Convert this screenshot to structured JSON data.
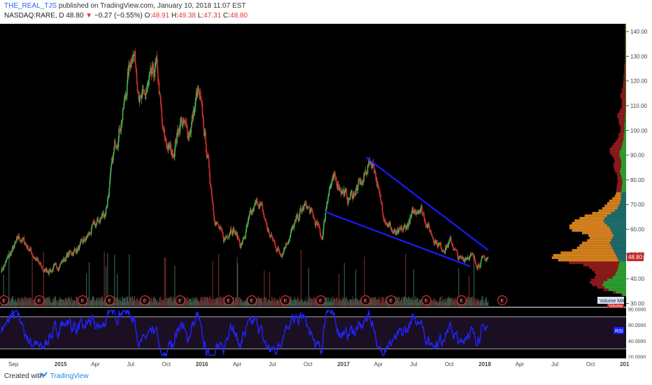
{
  "header": {
    "author": "THE_REAL_TJS",
    "published_text": "published on TradingView.com, January 10, 2018 11:07 EST",
    "symbol": "NASDAQ:RARE, D",
    "last": "48.80",
    "arrow": "▼",
    "change": "−0.27 (−0.55%)",
    "o_label": "O:",
    "o_value": "48.91",
    "h_label": "H:",
    "h_value": "49.38",
    "l_label": "L:",
    "l_value": "47.31",
    "c_label": "C:",
    "c_value": "48.80"
  },
  "footer": {
    "created": "Created with",
    "brand": "TradingView"
  },
  "colors": {
    "background": "#000000",
    "up": "#4caf50",
    "down": "#d32f2f",
    "trendline": "#1a1aff",
    "rsi": "#2323ff",
    "rsi_band": "#1b0f24",
    "vp_up": "#2e9e2e",
    "vp_down": "#8b1a1a",
    "vp_up_va": "#1e6b6b",
    "vp_down_va": "#d2801e",
    "price_tag": "#c62828",
    "earn": "#e53935"
  },
  "chart_data": {
    "type": "candlestick",
    "symbol": "NASDAQ:RARE",
    "interval": "D",
    "last_price": 48.8,
    "price_axis": {
      "ticks": [
        30,
        40,
        50,
        60,
        70,
        80,
        90,
        100,
        110,
        120,
        130,
        140
      ],
      "labels": [
        "30.00",
        "40.00",
        "50.00",
        "60.00",
        "70.00",
        "80.00",
        "90.00",
        "100.00",
        "110.00",
        "120.00",
        "130.00",
        "140.00"
      ],
      "ylim": [
        29,
        142
      ]
    },
    "time_axis": {
      "labels": [
        "Sep",
        "2015",
        "Apr",
        "Jul",
        "Oct",
        "2016",
        "Apr",
        "Jul",
        "Oct",
        "2017",
        "Apr",
        "Jul",
        "Oct",
        "2018",
        "Apr",
        "Jul",
        "Oct",
        "201"
      ],
      "start": "2014-08-01",
      "end": "2019-01-01"
    },
    "price_path": [
      [
        "2014-08-01",
        44
      ],
      [
        "2014-09-15",
        57
      ],
      [
        "2014-10-10",
        52
      ],
      [
        "2014-11-15",
        43
      ],
      [
        "2014-12-15",
        44
      ],
      [
        "2015-01-20",
        50
      ],
      [
        "2015-02-20",
        53
      ],
      [
        "2015-03-25",
        61
      ],
      [
        "2015-04-25",
        67
      ],
      [
        "2015-05-20",
        95
      ],
      [
        "2015-06-10",
        108
      ],
      [
        "2015-06-25",
        126
      ],
      [
        "2015-07-05",
        135
      ],
      [
        "2015-07-25",
        110
      ],
      [
        "2015-08-20",
        120
      ],
      [
        "2015-09-05",
        126
      ],
      [
        "2015-09-20",
        97
      ],
      [
        "2015-10-15",
        90
      ],
      [
        "2015-11-05",
        105
      ],
      [
        "2015-11-25",
        98
      ],
      [
        "2015-12-10",
        108
      ],
      [
        "2015-12-20",
        117
      ],
      [
        "2016-01-10",
        93
      ],
      [
        "2016-02-01",
        64
      ],
      [
        "2016-02-25",
        55
      ],
      [
        "2016-03-15",
        62
      ],
      [
        "2016-04-10",
        53
      ],
      [
        "2016-05-05",
        66
      ],
      [
        "2016-05-25",
        72
      ],
      [
        "2016-06-20",
        58
      ],
      [
        "2016-07-20",
        50
      ],
      [
        "2016-08-20",
        60
      ],
      [
        "2016-09-10",
        67
      ],
      [
        "2016-09-25",
        70
      ],
      [
        "2016-10-20",
        62
      ],
      [
        "2016-11-05",
        56
      ],
      [
        "2016-11-20",
        77
      ],
      [
        "2016-12-10",
        80
      ],
      [
        "2017-01-10",
        72
      ],
      [
        "2017-02-01",
        76
      ],
      [
        "2017-02-20",
        80
      ],
      [
        "2017-03-05",
        88
      ],
      [
        "2017-03-20",
        86
      ],
      [
        "2017-04-01",
        72
      ],
      [
        "2017-04-20",
        63
      ],
      [
        "2017-05-15",
        57
      ],
      [
        "2017-06-10",
        61
      ],
      [
        "2017-07-01",
        67
      ],
      [
        "2017-07-15",
        70
      ],
      [
        "2017-08-10",
        59
      ],
      [
        "2017-09-10",
        52
      ],
      [
        "2017-10-05",
        55
      ],
      [
        "2017-10-25",
        47
      ],
      [
        "2017-11-20",
        50
      ],
      [
        "2017-12-10",
        46
      ],
      [
        "2018-01-10",
        48.8
      ]
    ],
    "volume_ma_label": "Volume MA",
    "volume_label": "Volume",
    "earnings_label": "E",
    "earnings_dates": [
      "2014-08-08",
      "2014-11-07",
      "2015-02-27",
      "2015-05-08",
      "2015-08-07",
      "2015-11-06",
      "2016-03-10",
      "2016-05-09",
      "2016-08-04",
      "2016-11-03",
      "2017-02-27",
      "2017-05-04",
      "2017-08-03",
      "2017-11-02",
      "2018-02-15"
    ],
    "trendlines": [
      {
        "from": [
          "2017-03-01",
          89
        ],
        "to": [
          "2018-01-10",
          51.5
        ]
      },
      {
        "from": [
          "2016-11-15",
          67
        ],
        "to": [
          "2017-11-25",
          45
        ]
      }
    ],
    "volume_profile": {
      "bin_size": 1,
      "from": 33,
      "up": [
        6,
        16,
        28,
        34,
        38,
        36,
        30,
        22,
        18,
        16,
        14,
        13,
        12,
        11,
        12,
        14,
        16,
        18,
        20,
        22,
        24,
        26,
        24,
        22,
        20,
        22,
        24,
        26,
        30,
        34,
        36,
        34,
        30,
        24,
        18,
        14,
        12,
        10,
        9,
        8,
        8,
        8,
        8,
        7,
        7,
        6,
        6,
        7,
        8,
        9,
        10,
        9,
        8,
        8,
        8,
        9,
        10,
        11,
        10,
        8,
        7,
        6,
        5,
        4,
        4,
        4,
        3,
        3,
        3,
        3,
        2,
        2,
        2,
        2,
        1,
        1,
        1,
        1,
        1,
        1,
        1,
        1,
        1,
        1,
        1,
        1,
        1,
        1,
        1,
        1,
        1,
        1,
        1,
        1,
        1,
        1,
        1,
        1,
        1,
        1,
        1,
        1,
        1,
        1,
        1,
        1,
        1,
        1,
        1,
        1
      ],
      "down": [
        2,
        5,
        8,
        12,
        16,
        22,
        26,
        28,
        30,
        34,
        40,
        46,
        56,
        80,
        96,
        104,
        100,
        86,
        66,
        56,
        50,
        44,
        38,
        36,
        40,
        48,
        62,
        64,
        60,
        52,
        46,
        40,
        36,
        30,
        26,
        24,
        22,
        20,
        18,
        14,
        10,
        8,
        8,
        8,
        8,
        8,
        7,
        7,
        6,
        6,
        8,
        10,
        12,
        12,
        10,
        10,
        12,
        14,
        16,
        18,
        16,
        14,
        12,
        10,
        8,
        8,
        6,
        6,
        6,
        8,
        10,
        10,
        12,
        12,
        10,
        8,
        6,
        6,
        6,
        6,
        8,
        8,
        6,
        6,
        4,
        4,
        4,
        3,
        3,
        3,
        2,
        2,
        2,
        2,
        1,
        1,
        1,
        1,
        1,
        1,
        1,
        1,
        1,
        1,
        1,
        1,
        1,
        1,
        1,
        1
      ],
      "value_area": [
        47,
        75
      ]
    },
    "rsi": {
      "label": "RSI",
      "ticks": [
        20,
        40,
        60,
        80
      ],
      "tick_labels": [
        "20.0000",
        "40.0000",
        "60.0000",
        "80.0000"
      ],
      "ylim": [
        18,
        82
      ],
      "bands": [
        30,
        70
      ]
    }
  }
}
